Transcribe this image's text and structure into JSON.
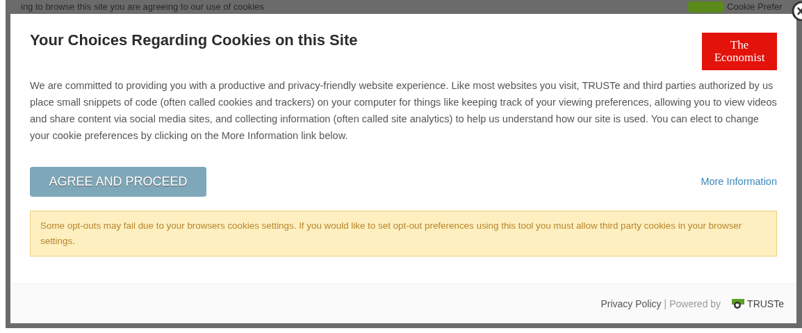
{
  "backdrop": {
    "notice": "ing to browse this site you are agreeing to our use of cookies",
    "cookie_link": "Cookie Prefer"
  },
  "dialog": {
    "title": "Your Choices Regarding Cookies on this Site",
    "logo": {
      "line_1": "The",
      "line_2": "Economist"
    },
    "body": "We are committed to providing you with a productive and privacy-friendly website experience. Like most websites you visit, TRUSTe and third parties authorized by us place small snippets of code (often called cookies and trackers) on your computer for things like keeping track of your viewing preferences, allowing you to view videos and share content via social media sites, and collecting information (often called site analytics) to help us understand how our site is used. You can elect to change your cookie preferences by clicking on the More Information link below.",
    "agree_button": "AGREE AND PROCEED",
    "more_link": "More Information",
    "warning": "Some opt-outs may fail due to your browsers cookies settings. If you would like to set opt-out preferences using this tool you must allow third party cookies in your browser settings.",
    "footer": {
      "privacy_link": "Privacy Policy",
      "separator": "|",
      "powered_by": "Powered by",
      "brand": "TRUSTe"
    }
  }
}
